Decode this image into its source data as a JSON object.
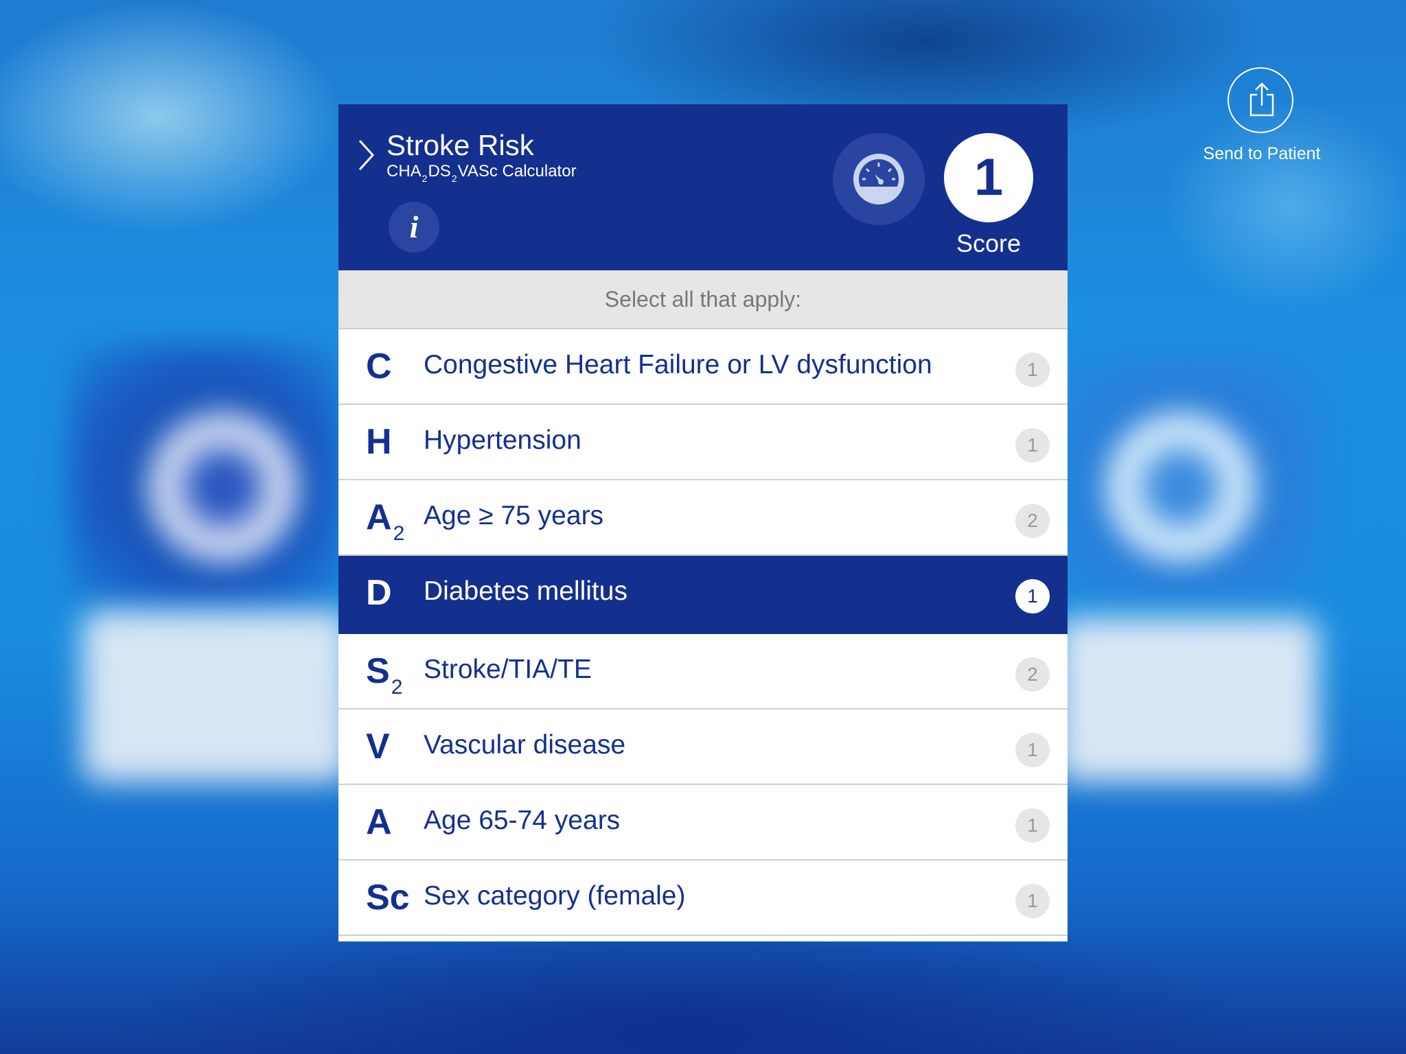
{
  "header": {
    "title": "Stroke Risk",
    "subtitle": {
      "part1": "CHA",
      "sub1": "2",
      "part2": "DS",
      "sub2": "2",
      "part3": "VASc Calculator"
    },
    "info_label": "i",
    "score_value": "1",
    "score_label": "Score"
  },
  "share": {
    "label": "Send to Patient",
    "icon": "share-icon"
  },
  "instructions": "Select all that apply:",
  "criteria": [
    {
      "letter": "C",
      "subscript": "",
      "label": "Congestive Heart Failure or LV dysfunction",
      "points": "1",
      "selected": false
    },
    {
      "letter": "H",
      "subscript": "",
      "label": "Hypertension",
      "points": "1",
      "selected": false
    },
    {
      "letter": "A",
      "subscript": "2",
      "label": "Age ≥ 75 years",
      "points": "2",
      "selected": false
    },
    {
      "letter": "D",
      "subscript": "",
      "label": "Diabetes mellitus",
      "points": "1",
      "selected": true
    },
    {
      "letter": "S",
      "subscript": "2",
      "label": "Stroke/TIA/TE",
      "points": "2",
      "selected": false
    },
    {
      "letter": "V",
      "subscript": "",
      "label": "Vascular disease",
      "points": "1",
      "selected": false
    },
    {
      "letter": "A",
      "subscript": "",
      "label": "Age 65-74 years",
      "points": "1",
      "selected": false
    },
    {
      "letter": "Sc",
      "subscript": "",
      "label": "Sex category (female)",
      "points": "1",
      "selected": false
    }
  ],
  "colors": {
    "brand_navy": "#14308e",
    "selected_row": "#14308e",
    "button_circle": "#2a45a0"
  }
}
